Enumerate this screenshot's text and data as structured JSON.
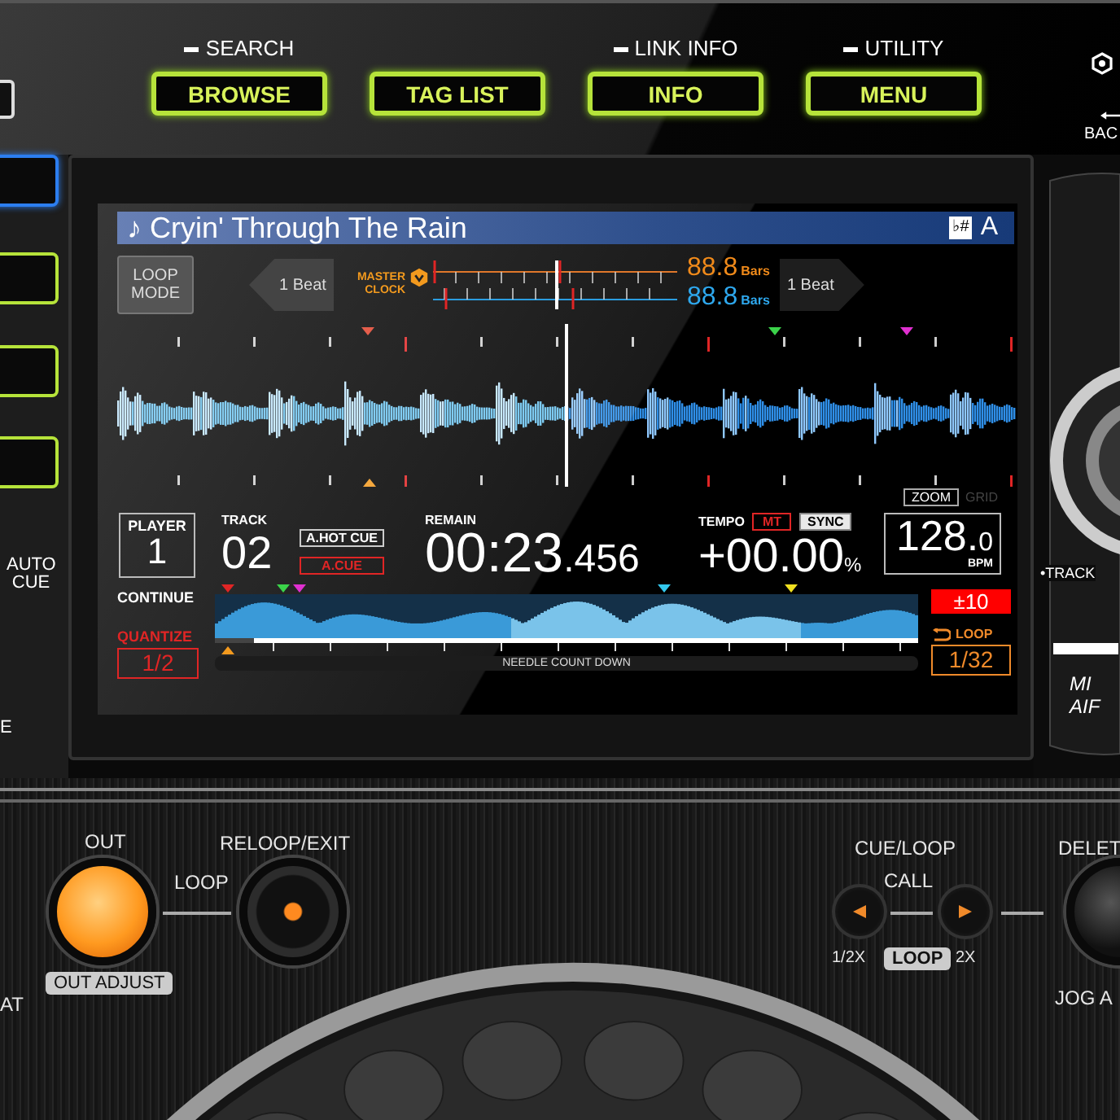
{
  "top_buttons": [
    {
      "caption": "SEARCH",
      "label": "BROWSE"
    },
    {
      "label": "TAG LIST"
    },
    {
      "caption": "LINK INFO",
      "label": "INFO"
    },
    {
      "caption": "UTILITY",
      "label": "MENU"
    }
  ],
  "top_right": {
    "back_label": "BAC"
  },
  "left_panel": {
    "auto_cue": "AUTO CUE",
    "cut_label": "E"
  },
  "display": {
    "title": "♪ Cryin' Through The Rain",
    "key_icon": "♭#",
    "key": "A",
    "loop_mode": "LOOP MODE",
    "beat_left": "1 Beat",
    "beat_right": "1 Beat",
    "master_clock": "MASTER CLOCK",
    "bars": [
      {
        "value": "88.8",
        "unit": "Bars",
        "kind": "master"
      },
      {
        "value": "88.8",
        "unit": "Bars",
        "kind": "slave"
      }
    ],
    "zoom": "ZOOM",
    "grid": "GRID",
    "player_label": "PLAYER",
    "player": "1",
    "continue": "CONTINUE",
    "quantize": "QUANTIZE",
    "quantize_value": "1/2",
    "track_label": "TRACK",
    "track": "02",
    "hot_cue": "A.HOT CUE",
    "auto_cue": "A.CUE",
    "remain_label": "REMAIN",
    "time": "00:23",
    "time_fraction": ".456",
    "tempo_label": "TEMPO",
    "mt": {
      "label": "MT",
      "on": true
    },
    "sync": {
      "label": "SYNC",
      "on": true
    },
    "tempo": "+00.00",
    "tempo_unit": "%",
    "bpm": "128.",
    "bpm_fraction": "0",
    "bpm_unit": "BPM",
    "tempo_range": "±10",
    "loop_label": "LOOP",
    "loop_value": "1/32",
    "position": {
      "level": 0.06
    },
    "needle_count": "NEEDLE COUNT DOWN"
  },
  "right_panel": {
    "track_label": "•TRACK",
    "brand_lines": [
      "MI",
      "AIF"
    ]
  },
  "bottom_panel": {
    "left_partial": "AT",
    "out": "OUT",
    "loop": "LOOP",
    "reloop": "RELOOP/EXIT",
    "out_adjust": "OUT ADJUST",
    "cue_loop": "CUE/LOOP",
    "call": "CALL",
    "half": "1/2X",
    "loop_badge": "LOOP",
    "double": "2X",
    "delete": "DELET",
    "jog": "JOG A"
  }
}
